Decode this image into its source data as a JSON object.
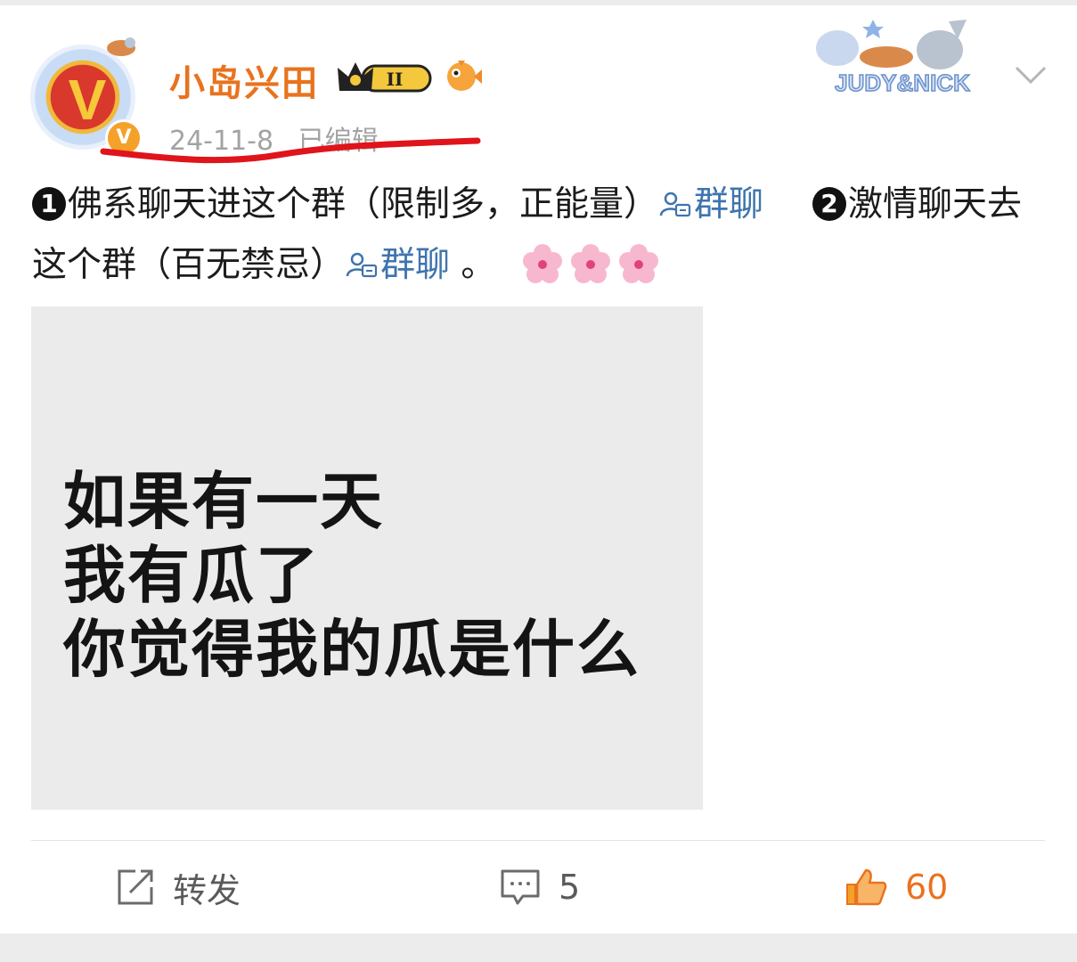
{
  "post": {
    "username": "小岛兴田",
    "level_badge": "II",
    "timestamp": "24-11-8",
    "edited_label": "已编辑",
    "banner_text": "JUDY&NICK",
    "text": {
      "num1": "1",
      "part1": "佛系聊天进这个群（限制多，正能量）",
      "link1": "群聊",
      "num2": "2",
      "part2": "激情聊天去这个群（百无禁忌）",
      "link2": "群聊",
      "ending": " 。"
    },
    "image_caption": "如果有一天\n我有瓜了\n你觉得我的瓜是什么"
  },
  "footer": {
    "repost_label": "转发",
    "comment_count": "5",
    "like_count": "60"
  },
  "colors": {
    "username": "#e8731e",
    "link": "#3f74ad",
    "like": "#e8731e",
    "underline": "#e0141b"
  },
  "icons": [
    "vip-v-icon",
    "crown-level-icon",
    "fish-icon",
    "chevron-down-icon",
    "group-chat-icon",
    "cherry-blossom-icon",
    "repost-icon",
    "comment-icon",
    "thumbs-up-icon"
  ]
}
